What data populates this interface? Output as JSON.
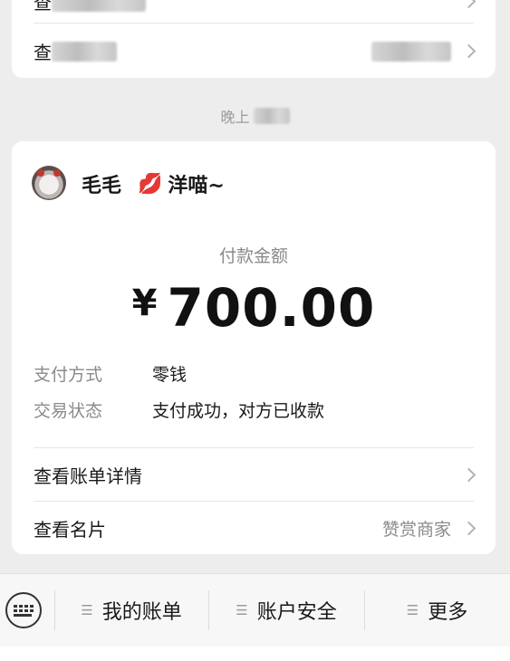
{
  "top_card": {
    "row1_prefix": "查",
    "row2_prefix": "查"
  },
  "time_label": "晚上",
  "payment": {
    "payer_name": "毛毛",
    "payee_name": "洋喵~",
    "lips_emoji": "💋",
    "amount_label": "付款金额",
    "currency_symbol": "¥",
    "amount": "700.00",
    "details": [
      {
        "key": "支付方式",
        "value": "零钱"
      },
      {
        "key": "交易状态",
        "value": "支付成功，对方已收款"
      }
    ],
    "links": [
      {
        "label": "查看账单详情",
        "right_text": ""
      },
      {
        "label": "查看名片",
        "right_text": "赞赏商家"
      }
    ]
  },
  "bottom_menu": {
    "items": [
      {
        "label": "我的账单"
      },
      {
        "label": "账户安全"
      },
      {
        "label": "更多"
      }
    ]
  },
  "colors": {
    "background": "#ededed",
    "card": "#ffffff",
    "muted_text": "#8a8a8a"
  }
}
